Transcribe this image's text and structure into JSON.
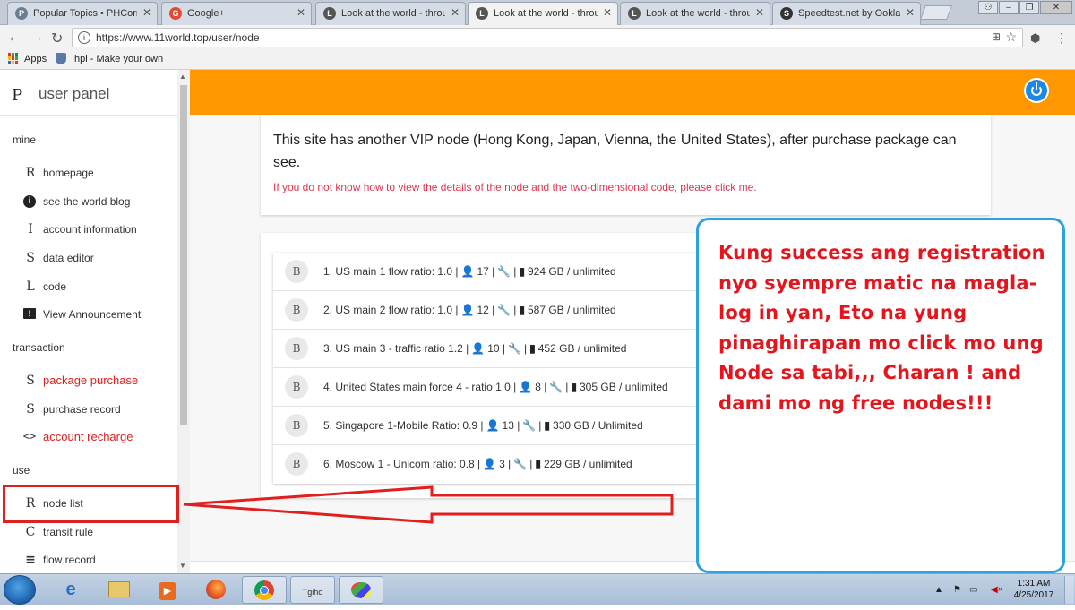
{
  "browser": {
    "tabs": [
      {
        "title": "Popular Topics • PHCorn",
        "fav": "P",
        "fav_color": "#6a7f95"
      },
      {
        "title": "Google+",
        "fav": "G",
        "fav_color": "#dd4b39"
      },
      {
        "title": "Look at the world - throu",
        "fav": "L",
        "fav_color": "#555555"
      },
      {
        "title": "Look at the world - throu",
        "fav": "L",
        "fav_color": "#555555"
      },
      {
        "title": "Look at the world - throu",
        "fav": "L",
        "fav_color": "#555555"
      },
      {
        "title": "Speedtest.net by Ookla -",
        "fav": "S",
        "fav_color": "#333333"
      }
    ],
    "active_tab": 3,
    "url": "https://www.11world.top/user/node",
    "bookmarks": [
      {
        "label": "Apps",
        "icon": "apps-grid-icon"
      },
      {
        "label": ".hpi - Make your own",
        "icon": "shield-icon"
      }
    ]
  },
  "sidebar": {
    "brand_letter": "P",
    "brand": "user panel",
    "sections": {
      "mine": "mine",
      "transaction": "transaction",
      "use": "use"
    },
    "items": [
      {
        "icon": "R",
        "label": "homepage"
      },
      {
        "icon": "i",
        "label": "see the world blog"
      },
      {
        "icon": "I",
        "label": "account information"
      },
      {
        "icon": "S",
        "label": "data editor"
      },
      {
        "icon": "L",
        "label": "code"
      },
      {
        "icon": "!",
        "label": "View Announcement"
      },
      {
        "icon": "S",
        "label": "package purchase"
      },
      {
        "icon": "S",
        "label": "purchase record"
      },
      {
        "icon": "<>",
        "label": "account recharge"
      },
      {
        "icon": "R",
        "label": "node list"
      },
      {
        "icon": "C",
        "label": "transit rule"
      },
      {
        "icon": "≡",
        "label": "flow record"
      }
    ]
  },
  "main": {
    "intro": "This site has another VIP node (Hong Kong, Japan, Vienna, the United States), after purchase package can see.",
    "help_link": "If you do not know how to view the details of the node and the two-dimensional code, please click me.",
    "nodes": [
      {
        "avatar": "B",
        "name": "1. US main 1 flow ratio: 1.0 |",
        "users": "17 |",
        "traffic": "924 GB / unlimited"
      },
      {
        "avatar": "B",
        "name": "2. US main 2 flow ratio: 1.0 |",
        "users": "12 |",
        "traffic": "587 GB / unlimited"
      },
      {
        "avatar": "B",
        "name": "3. US main 3 - traffic ratio 1.2 |",
        "users": "10 |",
        "traffic": "452 GB / unlimited"
      },
      {
        "avatar": "B",
        "name": "4. United States main force 4 - ratio 1.0 |",
        "users": "8 |",
        "traffic": "305 GB / unlimited"
      },
      {
        "avatar": "B",
        "name": "5. Singapore 1-Mobile Ratio: 0.9 |",
        "users": "13 |",
        "traffic": "330 GB / Unlimited"
      },
      {
        "avatar": "B",
        "name": "6. Moscow 1 - Unicom ratio: 0.8 |",
        "users": "3 |",
        "traffic": "229 GB / unlimited"
      }
    ]
  },
  "annotation": {
    "text": "Kung success ang registration nyo syempre matic na magla-log in yan, Eto na yung pinaghirapan mo click mo ung Node sa tabi,,, Charan ! and dami mo ng free nodes!!!"
  },
  "taskbar": {
    "time": "1:31 AM",
    "date": "4/25/2017",
    "apps": [
      "start",
      "ie-icon",
      "explorer-icon",
      "media-player-icon",
      "firefox-icon",
      "chrome-icon",
      "snipping-icon",
      "paint-icon"
    ]
  },
  "colors": {
    "accent_orange": "#ff9800",
    "link_red": "#e0364f",
    "annotation_red": "#e4151c",
    "annotation_blue": "#2aa3e0",
    "power_blue": "#1e88e5"
  }
}
